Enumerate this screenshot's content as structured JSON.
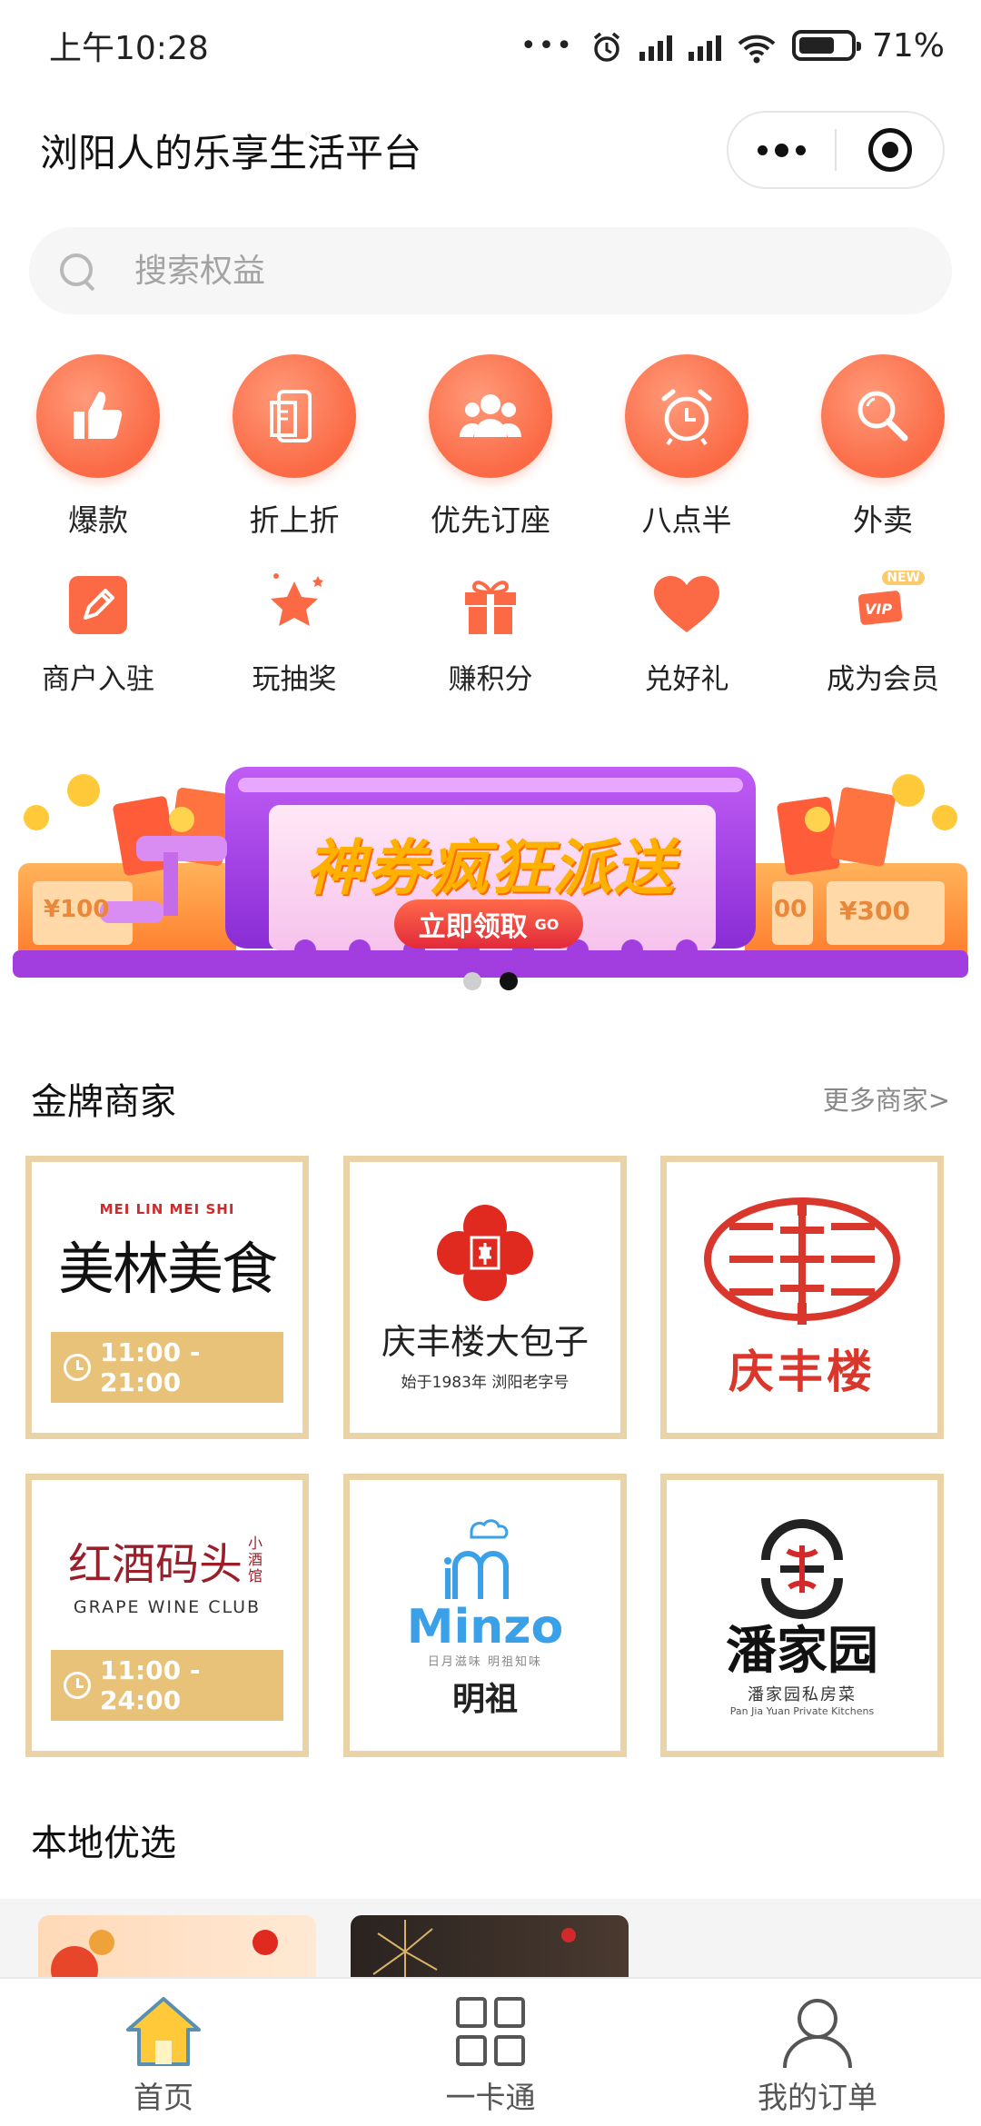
{
  "status_bar": {
    "time": "上午10:28",
    "battery": "71%"
  },
  "header": {
    "title": "浏阳人的乐享生活平台"
  },
  "search": {
    "placeholder": "搜索权益"
  },
  "categories_primary": [
    {
      "label": "爆款",
      "icon": "thumbs-up-icon"
    },
    {
      "label": "折上折",
      "icon": "phone-coupon-icon"
    },
    {
      "label": "优先订座",
      "icon": "people-group-icon"
    },
    {
      "label": "八点半",
      "icon": "alarm-clock-icon"
    },
    {
      "label": "外卖",
      "icon": "magnifier-icon"
    }
  ],
  "categories_secondary": [
    {
      "label": "商户入驻",
      "icon": "pencil-icon"
    },
    {
      "label": "玩抽奖",
      "icon": "star-icon"
    },
    {
      "label": "赚积分",
      "icon": "gift-icon"
    },
    {
      "label": "兑好礼",
      "icon": "heart-icon"
    },
    {
      "label": "成为会员",
      "icon": "vip-icon",
      "badge": "NEW"
    }
  ],
  "banner": {
    "headline": "神券疯狂派送",
    "cta": "立即领取",
    "cta_tag": "GO",
    "coupon_left": "¥100",
    "coupon_right": "¥300",
    "coupon_mid": "00",
    "slides": 2,
    "active_slide": 2
  },
  "gold_merchants": {
    "title": "金牌商家",
    "more": "更多商家>",
    "items": [
      {
        "top_text": "MEI LIN MEI SHI",
        "name": "美林美食",
        "hours": "11:00 - 21:00"
      },
      {
        "name": "庆丰楼大包子",
        "subtitle": "始于1983年  浏阳老字号"
      },
      {
        "name": "庆丰楼"
      },
      {
        "name": "红酒码头",
        "side": "小酒馆",
        "subtitle": "GRAPE  WINE CLUB",
        "hours": "11:00 - 24:00"
      },
      {
        "brand": "Minzo",
        "tagline": "日月滋味  明祖知味",
        "name": "明祖"
      },
      {
        "name": "潘家园",
        "subtitle": "潘家园私房菜",
        "tagline": "Pan Jia Yuan Private Kitchens"
      }
    ]
  },
  "local": {
    "title": "本地优选"
  },
  "tabbar": [
    {
      "label": "首页",
      "active": true
    },
    {
      "label": "一卡通",
      "active": false
    },
    {
      "label": "我的订单",
      "active": false
    }
  ],
  "colors": {
    "accent": "#fb6a45",
    "gold": "#e9c27a",
    "banner_purple": "#a23ee0",
    "red": "#e02a1f"
  }
}
